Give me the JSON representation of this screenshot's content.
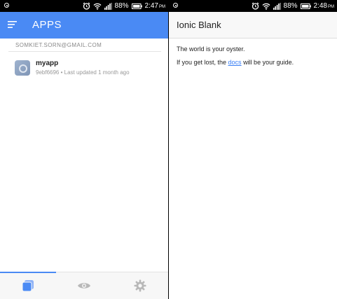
{
  "left_status": {
    "battery_pct": "88%",
    "time": "2:47",
    "ampm": "PM"
  },
  "right_status": {
    "battery_pct": "88%",
    "time": "2:48",
    "ampm": "PM"
  },
  "apps_screen": {
    "title": "APPS",
    "account_email": "SOMKIET.SORN@GMAIL.COM",
    "apps": [
      {
        "name": "myapp",
        "meta": "9ebf6696 • Last updated 1 month ago"
      }
    ],
    "tabs": [
      {
        "icon": "apps-icon",
        "active": true
      },
      {
        "icon": "eye-icon",
        "active": false
      },
      {
        "icon": "gear-icon",
        "active": false
      }
    ],
    "accent_color": "#4a8af4"
  },
  "ionic_screen": {
    "title": "Ionic Blank",
    "line1": "The world is your oyster.",
    "line2_prefix": "If you get lost, the ",
    "line2_link": "docs",
    "line2_suffix": " will be your guide.",
    "link_color": "#387ef5"
  }
}
